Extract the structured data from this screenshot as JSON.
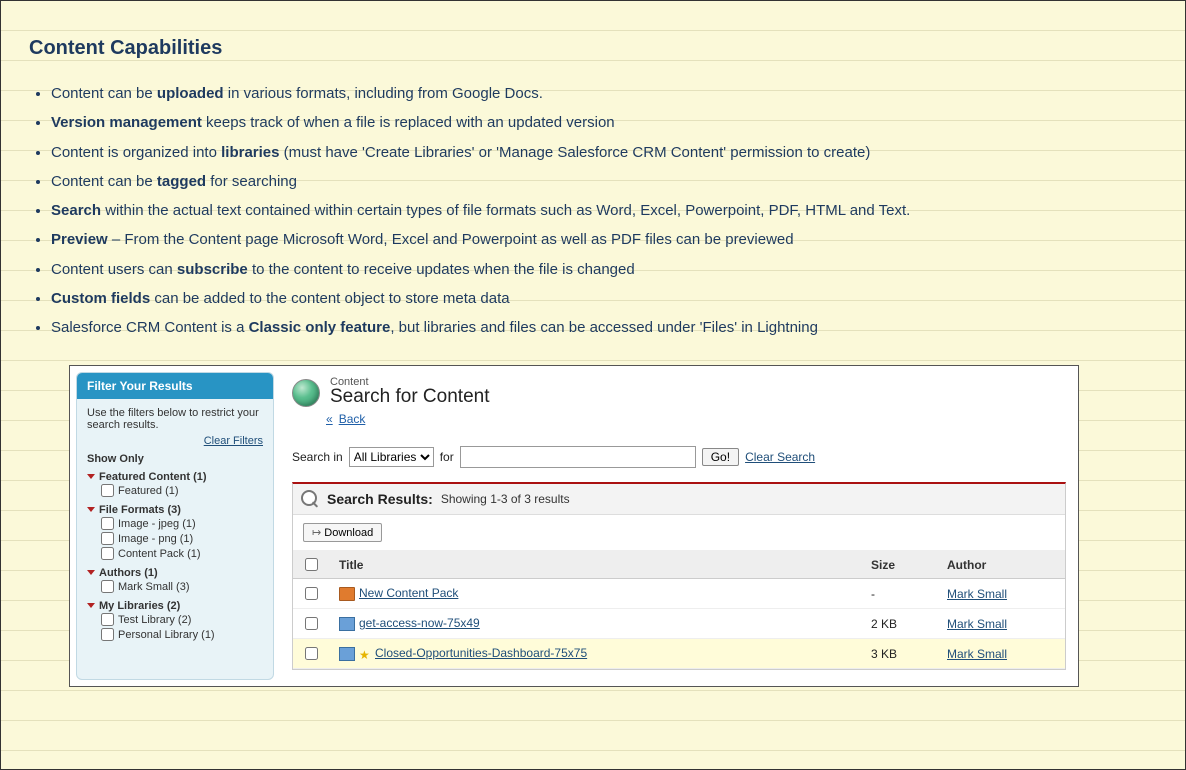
{
  "heading": "Content Capabilities",
  "bullets": [
    {
      "pre": "Content can be ",
      "b": "uploaded",
      "post": " in various formats, including from Google Docs."
    },
    {
      "pre": "",
      "b": "Version management",
      "post": " keeps track of when a file is replaced with an updated version"
    },
    {
      "pre": "Content is organized into ",
      "b": "libraries",
      "post": " (must have 'Create Libraries' or 'Manage Salesforce CRM Content' permission to create)"
    },
    {
      "pre": "Content can be ",
      "b": "tagged",
      "post": " for searching"
    },
    {
      "pre": "",
      "b": "Search",
      "post": " within the actual text contained within certain types of file formats such as Word, Excel, Powerpoint, PDF, HTML and Text."
    },
    {
      "pre": "",
      "b": "Preview",
      "post": " – From the Content page Microsoft Word, Excel and Powerpoint as well as PDF files can be previewed"
    },
    {
      "pre": "Content users can ",
      "b": "subscribe",
      "post": " to the content to receive updates when the file is changed"
    },
    {
      "pre": "",
      "b": "Custom fields",
      "post": " can be added to the content object to store meta data"
    },
    {
      "pre": "Salesforce CRM Content is a ",
      "b": "Classic only feature",
      "post": ", but libraries and files can be accessed under 'Files' in Lightning"
    }
  ],
  "sidebar": {
    "header": "Filter Your Results",
    "hint": "Use the filters below to restrict your search results.",
    "clear": "Clear Filters",
    "show_only": "Show Only",
    "groups": [
      {
        "label": "Featured Content (1)",
        "items": [
          {
            "label": "Featured (1)"
          }
        ]
      },
      {
        "label": "File Formats (3)",
        "items": [
          {
            "label": "Image - jpeg (1)"
          },
          {
            "label": "Image - png (1)"
          },
          {
            "label": "Content Pack (1)"
          }
        ]
      },
      {
        "label": "Authors (1)",
        "items": [
          {
            "label": "Mark Small (3)"
          }
        ]
      },
      {
        "label": "My Libraries (2)",
        "items": [
          {
            "label": "Test Library (2)"
          },
          {
            "label": "Personal Library (1)"
          }
        ]
      }
    ]
  },
  "content": {
    "eyebrow": "Content",
    "title": "Search for Content",
    "back": "Back",
    "searchbar": {
      "search_in": "Search in",
      "dropdown": "All Libraries",
      "for": "for",
      "input_value": "",
      "go": "Go!",
      "clear": "Clear Search"
    },
    "results": {
      "title": "Search Results:",
      "subtitle": "Showing 1-3 of 3 results",
      "download": "Download",
      "columns": {
        "title": "Title",
        "size": "Size",
        "author": "Author"
      },
      "rows": [
        {
          "icon": "box",
          "title": "New Content Pack",
          "size": "-",
          "author": "Mark Small",
          "hl": false
        },
        {
          "icon": "img",
          "title": "get-access-now-75x49",
          "size": "2 KB",
          "author": "Mark Small",
          "hl": false
        },
        {
          "icon": "img",
          "star": true,
          "title": "Closed-Opportunities-Dashboard-75x75",
          "size": "3 KB",
          "author": "Mark Small",
          "hl": true
        }
      ]
    }
  }
}
